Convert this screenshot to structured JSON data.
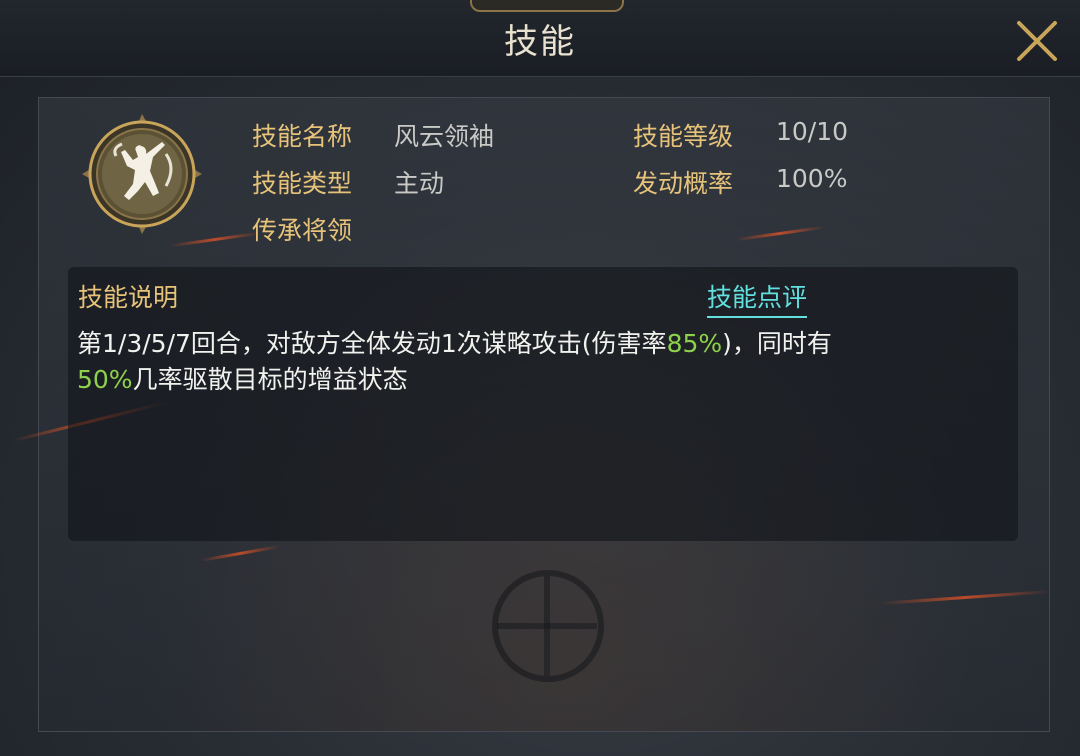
{
  "window": {
    "title": "技能"
  },
  "skill": {
    "icon": "warrior-figure-emblem-icon",
    "fields": [
      {
        "label": "技能名称",
        "value": "风云领袖"
      },
      {
        "label": "技能等级",
        "value": "10/10"
      },
      {
        "label": "技能类型",
        "value": "主动"
      },
      {
        "label": "发动概率",
        "value": "100%"
      },
      {
        "label": "传承将领",
        "value": ""
      }
    ]
  },
  "description": {
    "title": "技能说明",
    "review_link": "技能点评",
    "parts": [
      {
        "text": "第1/3/5/7回合，对敌方全体发动1次谋略攻击(伤害率"
      },
      {
        "text": "85%"
      },
      {
        "text": ")，同时有"
      },
      {
        "text": "50%"
      },
      {
        "text": "几率驱散目标的增益状态"
      }
    ],
    "highlight_color": "#8ed14a"
  },
  "colors": {
    "label": "#e7c37a",
    "value": "#c9c9c6",
    "link": "#62e0e0",
    "gold": "#c9a55a"
  }
}
